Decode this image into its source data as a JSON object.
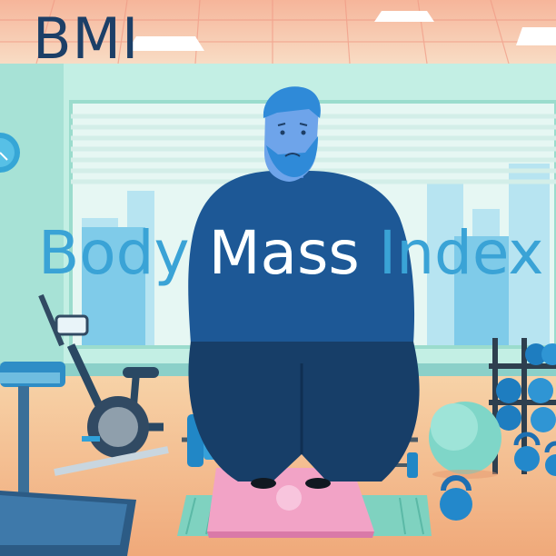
{
  "headline": "BMI",
  "subheadline": "Body Mass Index",
  "colors": {
    "headline": "#1c3f67",
    "subheadline": "#3aa3d6",
    "subheadline_over_figure": "#ffffff",
    "ceiling": "#f4b8a0",
    "wall": "#bfeee2",
    "floor": "#f2c69b",
    "shirt": "#1d5896",
    "pants": "#173e68",
    "skin": "#5d97e4"
  },
  "icons": [
    "ceiling-light-icon",
    "wall-clock-icon",
    "treadmill-icon",
    "exercise-bike-icon",
    "barbell-icon",
    "dumbbell-icon",
    "kettlebell-icon",
    "exercise-ball-icon",
    "weight-scale-icon",
    "yoga-mat-icon",
    "person-icon"
  ]
}
